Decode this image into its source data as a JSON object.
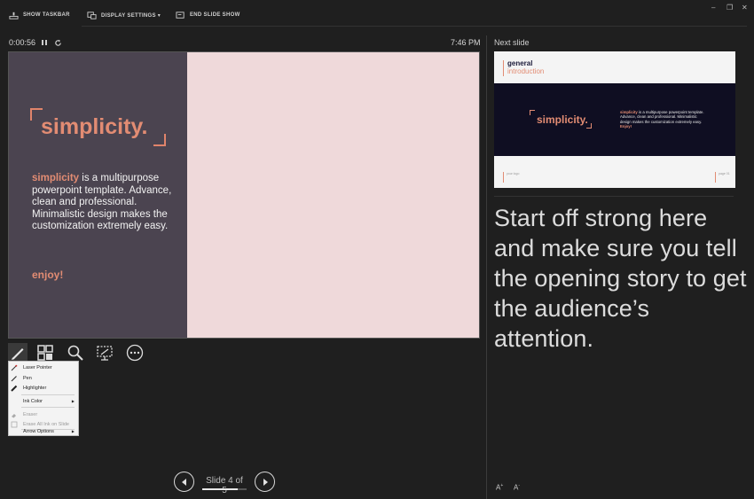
{
  "toolbar": {
    "show_taskbar": "SHOW TASKBAR",
    "display_settings": "DISPLAY SETTINGS ▾",
    "end_slide_show": "END SLIDE SHOW"
  },
  "window_controls": {
    "minimize": "–",
    "restore": "❐",
    "close": "✕"
  },
  "timer": {
    "elapsed": "0:00:56",
    "clock": "7:46 PM"
  },
  "next_slide_label": "Next slide",
  "current_slide": {
    "title": "simplicity.",
    "body_highlight": "simplicity",
    "body_text": " is a multipurpose powerpoint template. Advance, clean and professional. Minimalistic design makes the customization extremely easy.",
    "enjoy": "enjoy!"
  },
  "next_slide": {
    "header_line1": "general",
    "header_line2": "introduction",
    "title": "simplicity.",
    "body_highlight": "simplicity",
    "body_text": " is a multipurpose powerpoint template. Advance, clean and professional. Minimalistic design makes the customization extremely easy. ",
    "enjoy": "Enjoy!",
    "footer_left": "your logo",
    "footer_right": "page 01"
  },
  "pen_menu": {
    "items": [
      {
        "label": "Laser Pointer",
        "icon": "laser-pointer-icon",
        "disabled": false,
        "submenu": false
      },
      {
        "label": "Pen",
        "icon": "pen-icon",
        "disabled": false,
        "submenu": false
      },
      {
        "label": "Highlighter",
        "icon": "highlighter-icon",
        "disabled": false,
        "submenu": false
      },
      {
        "label": "Ink Color",
        "icon": "",
        "disabled": false,
        "submenu": true
      },
      {
        "label": "Eraser",
        "icon": "eraser-icon",
        "disabled": true,
        "submenu": false
      },
      {
        "label": "Erase All Ink on Slide",
        "icon": "erase-all-icon",
        "disabled": true,
        "submenu": false
      },
      {
        "label": "Arrow Options",
        "icon": "",
        "disabled": false,
        "submenu": true
      }
    ]
  },
  "navigation": {
    "slide_counter": "Slide 4 of 5",
    "progress": 0.8
  },
  "notes": "Start off strong here and make sure you tell the opening story to get the audience’s attention.",
  "font_controls": {
    "increase": "A",
    "decrease": "A"
  },
  "colors": {
    "accent": "#e28c73",
    "background": "#1f1f1f",
    "slide_left": "#4b4450",
    "slide_right": "#efd9da"
  }
}
